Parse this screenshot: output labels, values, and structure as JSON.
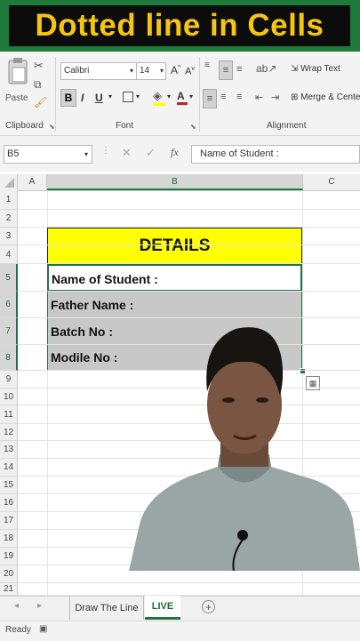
{
  "banner": {
    "title": "Dotted line in Cells"
  },
  "ribbon": {
    "clipboard": {
      "paste": "Paste",
      "label": "Clipboard"
    },
    "font": {
      "name": "Calibri",
      "size": "14",
      "bold": "B",
      "italic": "I",
      "underline": "U",
      "label": "Font"
    },
    "alignment": {
      "wrap": "Wrap Text",
      "merge": "Merge & Cente",
      "label": "Alignment"
    }
  },
  "formula_bar": {
    "name_box": "B5",
    "fx": "fx",
    "content": "Name of Student  :"
  },
  "grid": {
    "columns": [
      "A",
      "B",
      "C"
    ],
    "rows": [
      "1",
      "2",
      "3",
      "4",
      "5",
      "6",
      "7",
      "8",
      "9",
      "10",
      "11",
      "12",
      "13",
      "14",
      "15",
      "16",
      "17",
      "18",
      "19",
      "20",
      "21"
    ]
  },
  "table": {
    "header": "DETAILS",
    "rows": [
      "Name of Student  :",
      "Father Name :",
      "Batch No :",
      "Modile No :"
    ]
  },
  "sheets": {
    "tabs": [
      "Draw The Line",
      "LIVE"
    ],
    "add": "+"
  },
  "status": {
    "text": "Ready"
  },
  "colors": {
    "header_fill": "#ffff00",
    "row_fill": "#c8c8c8",
    "banner_bg": "#1e7a3a",
    "banner_text": "#f6c60f"
  }
}
